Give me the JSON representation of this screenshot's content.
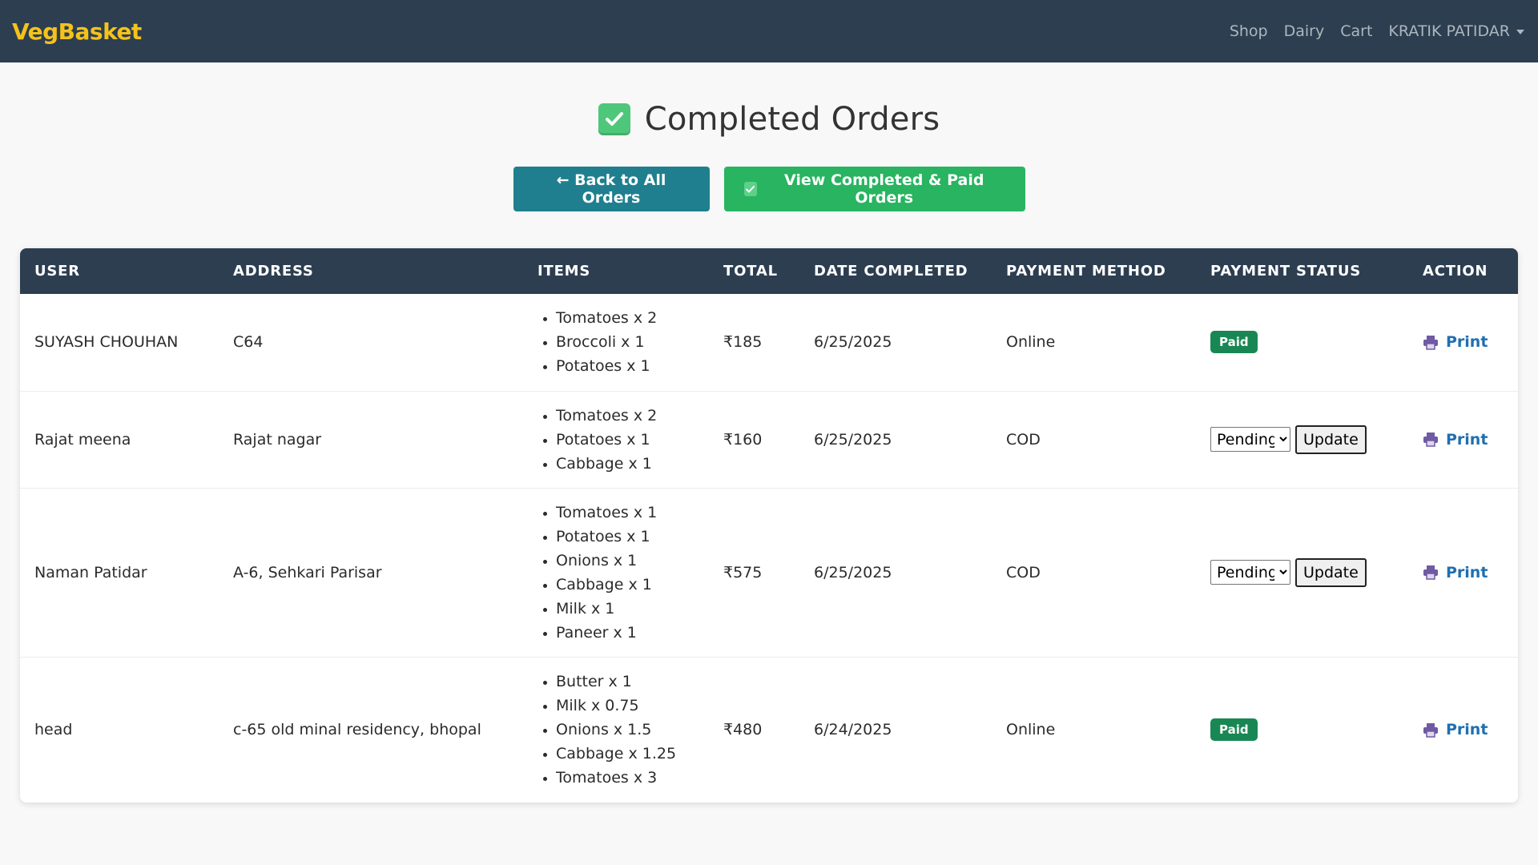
{
  "navbar": {
    "brand": "VegBasket",
    "links": [
      "Shop",
      "Dairy",
      "Cart"
    ],
    "user": "KRATIK PATIDAR"
  },
  "page": {
    "title": "Completed Orders",
    "back_button": "← Back to All Orders",
    "view_paid_button": "View Completed & Paid Orders"
  },
  "table": {
    "headers": [
      "USER",
      "ADDRESS",
      "ITEMS",
      "TOTAL",
      "DATE COMPLETED",
      "PAYMENT METHOD",
      "PAYMENT STATUS",
      "ACTION"
    ],
    "rows": [
      {
        "user": "SUYASH CHOUHAN",
        "address": "C64",
        "items": [
          "Tomatoes x 2",
          "Broccoli x 1",
          "Potatoes x 1"
        ],
        "total": "₹185",
        "date": "6/25/2025",
        "method": "Online",
        "status": "Paid",
        "action": "Print"
      },
      {
        "user": "Rajat meena",
        "address": "Rajat nagar",
        "items": [
          "Tomatoes x 2",
          "Potatoes x 1",
          "Cabbage x 1"
        ],
        "total": "₹160",
        "date": "6/25/2025",
        "method": "COD",
        "status_select": "Pending",
        "update_label": "Update",
        "action": "Print"
      },
      {
        "user": "Naman Patidar",
        "address": "A-6, Sehkari Parisar",
        "items": [
          "Tomatoes x 1",
          "Potatoes x 1",
          "Onions x 1",
          "Cabbage x 1",
          "Milk x 1",
          "Paneer x 1"
        ],
        "total": "₹575",
        "date": "6/25/2025",
        "method": "COD",
        "status_select": "Pending",
        "update_label": "Update",
        "action": "Print"
      },
      {
        "user": "head",
        "address": "c-65 old minal residency, bhopal",
        "items": [
          "Butter x 1",
          "Milk x 0.75",
          "Onions x 1.5",
          "Cabbage x 1.25",
          "Tomatoes x 3"
        ],
        "total": "₹480",
        "date": "6/24/2025",
        "method": "Online",
        "status": "Paid",
        "action": "Print"
      }
    ]
  }
}
